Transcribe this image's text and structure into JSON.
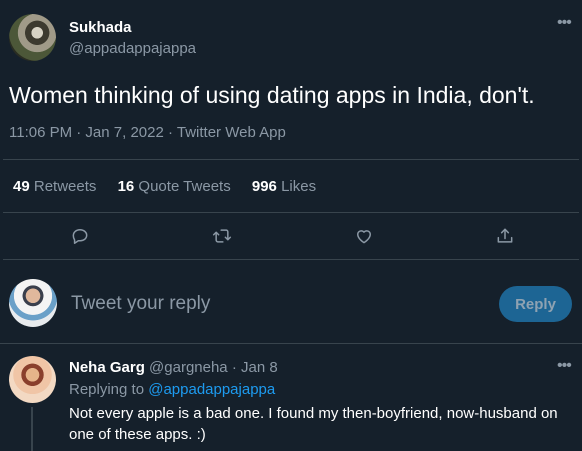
{
  "tweet": {
    "author_name": "Sukhada",
    "author_handle": "@appadappajappa",
    "text": "Women thinking of using dating apps in India, don't.",
    "meta": "11:06 PM · Jan 7, 2022 · Twitter Web App",
    "more_icon": "ellipsis-icon"
  },
  "stats": {
    "retweets_count": "49",
    "retweets_label": "Retweets",
    "quote_count": "16",
    "quote_label": "Quote Tweets",
    "likes_count": "996",
    "likes_label": "Likes"
  },
  "actions": [
    {
      "icon": "reply-icon"
    },
    {
      "icon": "retweet-icon"
    },
    {
      "icon": "heart-icon"
    },
    {
      "icon": "share-icon"
    }
  ],
  "composer": {
    "placeholder": "Tweet your reply",
    "button_label": "Reply"
  },
  "reply": {
    "author_name": "Neha Garg",
    "author_handle": "@gargneha",
    "separator": "·",
    "date": "Jan 8",
    "replying_prefix": "Replying to",
    "replying_handle": "@appadappajappa",
    "text": "Not every apple is a bad one. I found my then-boyfriend, now-husband on one of these apps. :)"
  },
  "colors": {
    "background": "#15202b",
    "divider": "#38444d",
    "accent": "#1d9bf0",
    "secondary_text": "#8b98a5"
  }
}
